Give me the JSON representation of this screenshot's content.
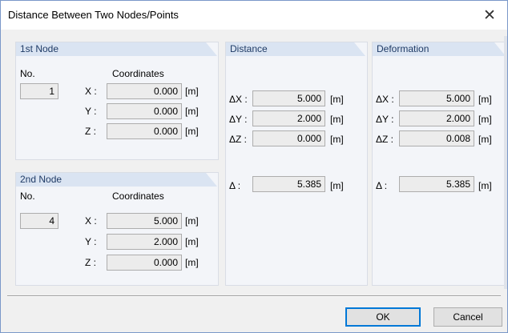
{
  "window": {
    "title": "Distance Between Two Nodes/Points",
    "close_glyph": "✕"
  },
  "node1": {
    "header": "1st Node",
    "no_label": "No.",
    "coords_label": "Coordinates",
    "number": "1",
    "x_label": "X :",
    "y_label": "Y :",
    "z_label": "Z :",
    "x": "0.000",
    "y": "0.000",
    "z": "0.000",
    "unit": "[m]"
  },
  "node2": {
    "header": "2nd Node",
    "no_label": "No.",
    "coords_label": "Coordinates",
    "number": "4",
    "x_label": "X :",
    "y_label": "Y :",
    "z_label": "Z :",
    "x": "5.000",
    "y": "2.000",
    "z": "0.000",
    "unit": "[m]"
  },
  "distance": {
    "header": "Distance",
    "dx_label": "ΔX :",
    "dy_label": "ΔY :",
    "dz_label": "ΔZ :",
    "d_label": "Δ :",
    "dx": "5.000",
    "dy": "2.000",
    "dz": "0.000",
    "d": "5.385",
    "unit": "[m]"
  },
  "deformation": {
    "header": "Deformation",
    "dx_label": "ΔX :",
    "dy_label": "ΔY :",
    "dz_label": "ΔZ :",
    "d_label": "Δ :",
    "dx": "5.000",
    "dy": "2.000",
    "dz": "0.008",
    "d": "5.385",
    "unit": "[m]"
  },
  "buttons": {
    "ok": "OK",
    "cancel": "Cancel"
  },
  "colors": {
    "header_bg": "#dae4f2",
    "panel_bg": "#f3f5f9",
    "default_border": "#0078d7"
  }
}
